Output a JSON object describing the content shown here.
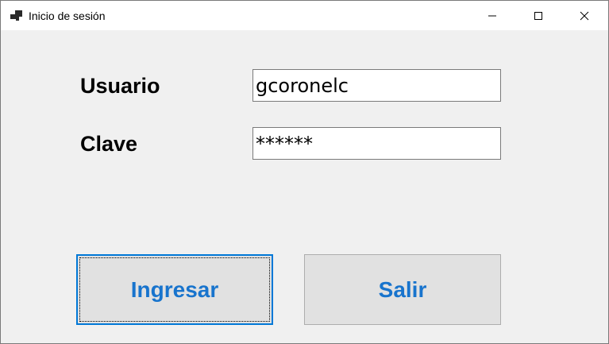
{
  "window": {
    "title": "Inicio de sesión",
    "icons": {
      "app": "app-icon",
      "minimize": "minimize-icon",
      "maximize": "maximize-icon",
      "close": "close-icon"
    }
  },
  "form": {
    "user_label": "Usuario",
    "user_value": "gcoronelc",
    "password_label": "Clave",
    "password_value": "******"
  },
  "buttons": {
    "login_label": "Ingresar",
    "exit_label": "Salir"
  },
  "colors": {
    "button_text": "#1874cd",
    "focus_border": "#0078d7",
    "window_background": "#f0f0f0"
  }
}
